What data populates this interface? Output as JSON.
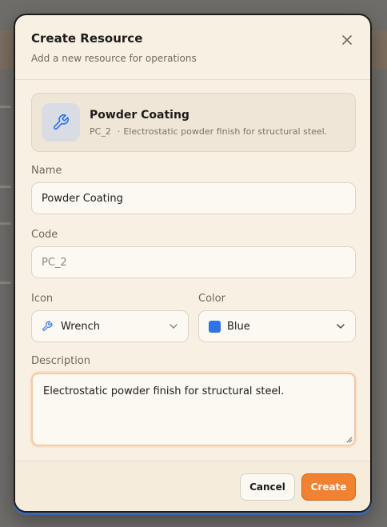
{
  "dialog": {
    "title": "Create Resource",
    "subtitle": "Add a new resource for operations",
    "close_icon": "close-icon"
  },
  "preview": {
    "icon": "wrench-icon",
    "name": "Powder Coating",
    "code": "PC_2",
    "separator": "·",
    "description": "Electrostatic powder finish for structural steel."
  },
  "form": {
    "name": {
      "label": "Name",
      "value": "Powder Coating"
    },
    "code": {
      "label": "Code",
      "value": "PC_2"
    },
    "icon": {
      "label": "Icon",
      "value": "Wrench",
      "icon": "wrench-icon"
    },
    "color": {
      "label": "Color",
      "value": "Blue",
      "swatch": "#2f73e6"
    },
    "description": {
      "label": "Description",
      "value": "Electrostatic powder finish for structural steel."
    }
  },
  "footer": {
    "cancel_label": "Cancel",
    "create_label": "Create"
  },
  "colors": {
    "accent": "#f08232",
    "icon_blue": "#2f73e6"
  }
}
